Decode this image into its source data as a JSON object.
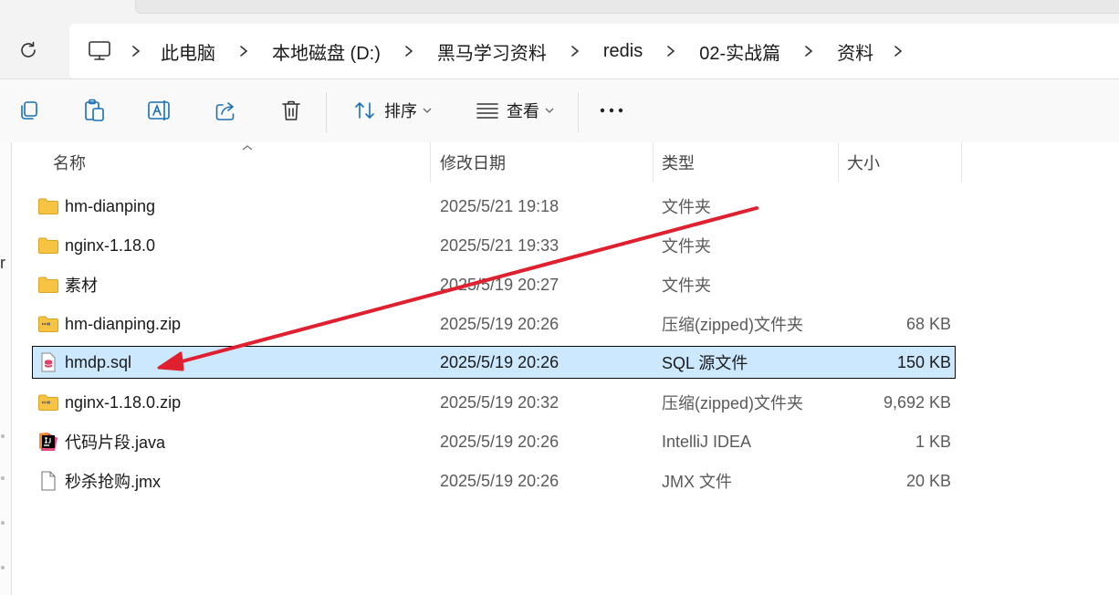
{
  "breadcrumb": [
    "此电脑",
    "本地磁盘 (D:)",
    "黑马学习资料",
    "redis",
    "02-实战篇",
    "资料"
  ],
  "toolbar": {
    "sort_label": "排序",
    "view_label": "查看"
  },
  "columns": {
    "name": "名称",
    "modified": "修改日期",
    "type": "类型",
    "size": "大小"
  },
  "files": [
    {
      "name": "hm-dianping",
      "modified": "2025/5/21 19:18",
      "type": "文件夹",
      "size": "",
      "icon": "folder-icon"
    },
    {
      "name": "nginx-1.18.0",
      "modified": "2025/5/21 19:33",
      "type": "文件夹",
      "size": "",
      "icon": "folder-icon"
    },
    {
      "name": "素材",
      "modified": "2025/5/19 20:27",
      "type": "文件夹",
      "size": "",
      "icon": "folder-icon"
    },
    {
      "name": "hm-dianping.zip",
      "modified": "2025/5/19 20:26",
      "type": "压缩(zipped)文件夹",
      "size": "68 KB",
      "icon": "zip-folder-icon"
    },
    {
      "name": "hmdp.sql",
      "modified": "2025/5/19 20:26",
      "type": "SQL 源文件",
      "size": "150 KB",
      "icon": "sql-file-icon",
      "selected": true
    },
    {
      "name": "nginx-1.18.0.zip",
      "modified": "2025/5/19 20:32",
      "type": "压缩(zipped)文件夹",
      "size": "9,692 KB",
      "icon": "zip-folder-icon"
    },
    {
      "name": "代码片段.java",
      "modified": "2025/5/19 20:26",
      "type": "IntelliJ IDEA",
      "size": "1 KB",
      "icon": "intellij-file-icon"
    },
    {
      "name": "秒杀抢购.jmx",
      "modified": "2025/5/19 20:26",
      "type": "JMX 文件",
      "size": "20 KB",
      "icon": "generic-file-icon"
    }
  ],
  "left_edge_glyph": "r",
  "colors": {
    "selection": "#cce8ff",
    "arrow": "#e0202e",
    "folder": "#f6c343"
  }
}
